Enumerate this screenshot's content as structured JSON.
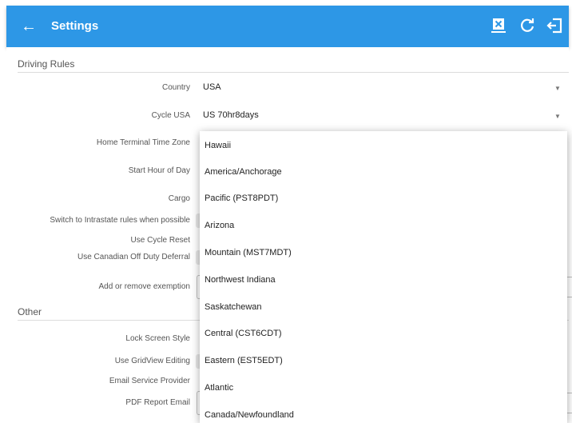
{
  "appbar": {
    "title": "Settings",
    "icons": [
      "back-arrow-icon",
      "export-icon",
      "refresh-icon",
      "logout-icon"
    ]
  },
  "sections": {
    "driving_rules": "Driving Rules",
    "other": "Other"
  },
  "settings": {
    "country": {
      "label": "Country",
      "value": "USA"
    },
    "cycle": {
      "label": "Cycle USA",
      "value": "US 70hr8days"
    },
    "home_tz": {
      "label": "Home Terminal Time Zone"
    },
    "start_hour": {
      "label": "Start Hour of Day"
    },
    "cargo": {
      "label": "Cargo"
    },
    "intrastate": {
      "label": "Switch to Intrastate rules when possible"
    },
    "cycle_reset": {
      "label": "Use Cycle Reset"
    },
    "canadian_off": {
      "label": "Use Canadian Off Duty Deferral"
    },
    "exemption": {
      "label": "Add or remove exemption"
    },
    "lock_screen": {
      "label": "Lock Screen Style"
    },
    "gridview": {
      "label": "Use GridView Editing"
    },
    "email_provider": {
      "label": "Email Service Provider"
    },
    "pdf_email": {
      "label": "PDF Report Email"
    }
  },
  "timezone_options": [
    "Hawaii",
    "America/Anchorage",
    "Pacific (PST8PDT)",
    "Arizona",
    "Mountain (MST7MDT)",
    "Northwest Indiana",
    "Saskatchewan",
    "Central (CST6CDT)",
    "Eastern (EST5EDT)",
    "Atlantic",
    "Canada/Newfoundland"
  ],
  "colors": {
    "appbar": "#2d97e6",
    "text": "#222222",
    "label": "#555555"
  }
}
